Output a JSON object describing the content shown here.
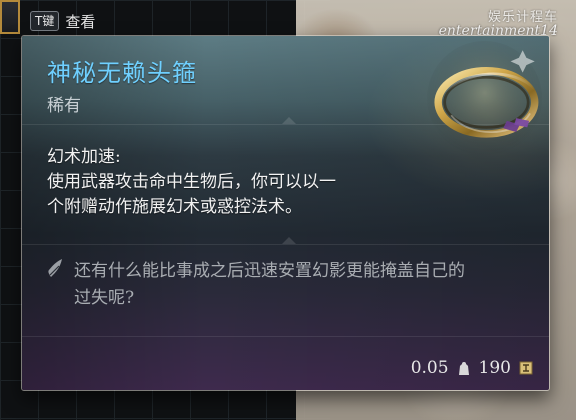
{
  "hint": {
    "key": "T键",
    "label": "查看"
  },
  "watermark": {
    "line1": "娱乐计程车",
    "line2": "entertainment14"
  },
  "item": {
    "name": "神秘无赖头箍",
    "rarity": "稀有",
    "description": {
      "title": "幻术加速:",
      "lines": [
        "使用武器攻击命中生物后，你可以以一",
        "个附赠动作施展幻术或惑控法术。"
      ]
    },
    "lore": {
      "lines": [
        "还有什么能比事成之后迅速安置幻影更能掩盖自己的",
        "过失呢?"
      ]
    },
    "weight": "0.05",
    "value": "190"
  },
  "colors": {
    "name": "#6fd0ff",
    "rarity": "#c8d0d4",
    "lore": "#a9adb2",
    "accent_gold": "#b48a3b",
    "panel_top": "#5d7c84",
    "panel_bottom": "#3e2a4d"
  },
  "icons": {
    "weight": "weight-icon",
    "value": "coin-icon",
    "lore": "quill-icon"
  }
}
